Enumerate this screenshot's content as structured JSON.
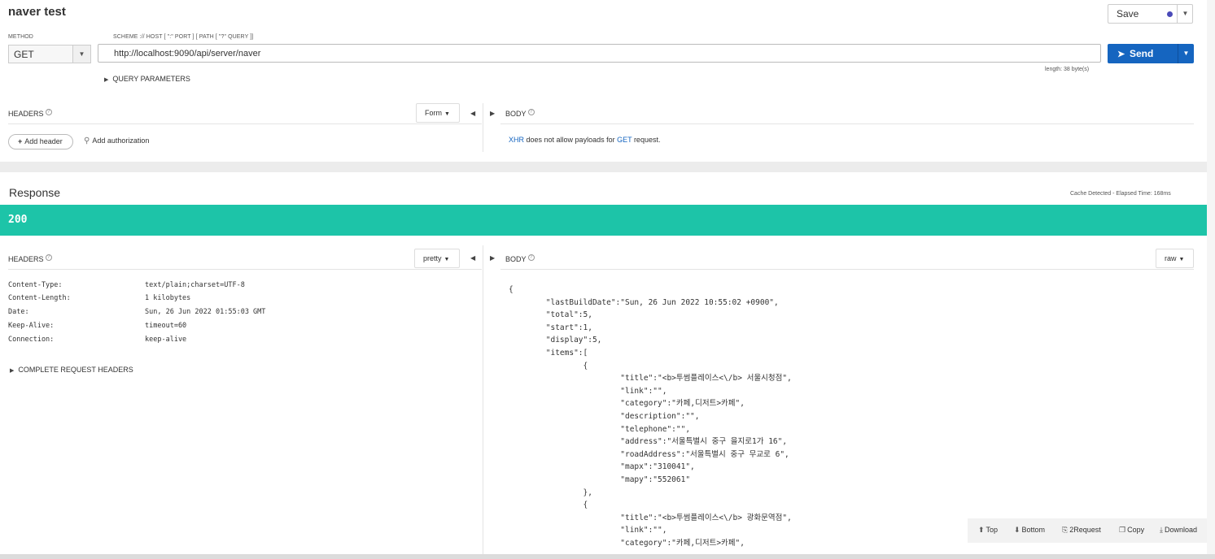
{
  "request": {
    "title": "naver test",
    "save_label": "Save",
    "method_label": "METHOD",
    "method_value": "GET",
    "url_label": "SCHEME :// HOST [ \":\" PORT ] [ PATH [ \"?\" QUERY ]]",
    "url_value": "http://localhost:9090/api/server/naver",
    "send_label": "Send",
    "length_info": "length: 38 byte(s)",
    "query_params_label": "QUERY PARAMETERS",
    "headers_label": "HEADERS",
    "headers_mode": "Form",
    "body_label": "BODY",
    "add_header_label": "Add header",
    "add_auth_label": "Add authorization",
    "body_note": {
      "prefix": "XHR",
      "middle": " does not allow payloads for ",
      "method": "GET",
      "suffix": " request."
    }
  },
  "response": {
    "title": "Response",
    "elapsed_info": "Cache Detected - Elapsed Time: 168ms",
    "status_code": "200",
    "headers_label": "HEADERS",
    "headers_format": "pretty",
    "body_label": "BODY",
    "body_format": "raw",
    "headers": [
      {
        "name": "Content-Type:",
        "value": "text/plain;charset=UTF-8"
      },
      {
        "name": "Content-Length:",
        "value": "1 kilobytes"
      },
      {
        "name": "Date:",
        "value": "Sun, 26 Jun 2022 01:55:03 GMT"
      },
      {
        "name": "Keep-Alive:",
        "value": "timeout=60"
      },
      {
        "name": "Connection:",
        "value": "keep-alive"
      }
    ],
    "complete_headers_label": "COMPLETE REQUEST HEADERS",
    "body_lines": [
      "{",
      "        \"lastBuildDate\":\"Sun, 26 Jun 2022 10:55:02 +0900\",",
      "        \"total\":5,",
      "        \"start\":1,",
      "        \"display\":5,",
      "        \"items\":[",
      "                {",
      "                        \"title\":\"<b>투썸플레이스<\\/b> 서울시청점\",",
      "                        \"link\":\"\",",
      "                        \"category\":\"카페,디저트>카페\",",
      "                        \"description\":\"\",",
      "                        \"telephone\":\"\",",
      "                        \"address\":\"서울특별시 중구 을지로1가 16\",",
      "                        \"roadAddress\":\"서울특별시 중구 무교로 6\",",
      "                        \"mapx\":\"310041\",",
      "                        \"mapy\":\"552061\"",
      "                },",
      "                {",
      "                        \"title\":\"<b>투썸플레이스<\\/b> 광화문역점\",",
      "                        \"link\":\"\",",
      "                        \"category\":\"카페,디저트>카페\","
    ]
  },
  "toolbar": {
    "top": "Top",
    "bottom": "Bottom",
    "to_request": "2Request",
    "copy": "Copy",
    "download": "Download"
  },
  "colors": {
    "status_success": "#1dc4a8",
    "primary": "#1565c0",
    "page_background": "#ececec"
  },
  "icons": [
    "chevron-down-icon",
    "paper-plane-icon",
    "triangle-right-icon",
    "help-icon",
    "plus-icon",
    "key-icon",
    "arrow-left-icon",
    "arrow-right-icon",
    "arrow-up-circle-icon",
    "arrow-down-circle-icon",
    "clipboard-icon",
    "copy-icon",
    "download-icon"
  ]
}
